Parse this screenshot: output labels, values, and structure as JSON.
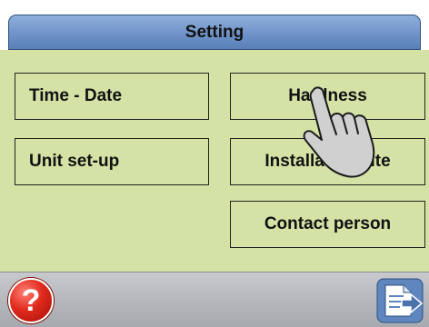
{
  "header": {
    "title": "Setting"
  },
  "menu": {
    "time_date": "Time - Date",
    "unit_setup": "Unit set-up",
    "hardness": "Hardness",
    "installation_site": "Installation site",
    "contact_person": "Contact person"
  },
  "footer": {
    "help_symbol": "?"
  },
  "icons": {
    "help": "help-icon",
    "back": "back-document-icon",
    "pointer": "hand-pointer-icon"
  },
  "colors": {
    "title_bar": "#6f93c8",
    "panel": "#d4e2a6",
    "footer": "#b3b6ba",
    "help": "#e02a1d"
  }
}
